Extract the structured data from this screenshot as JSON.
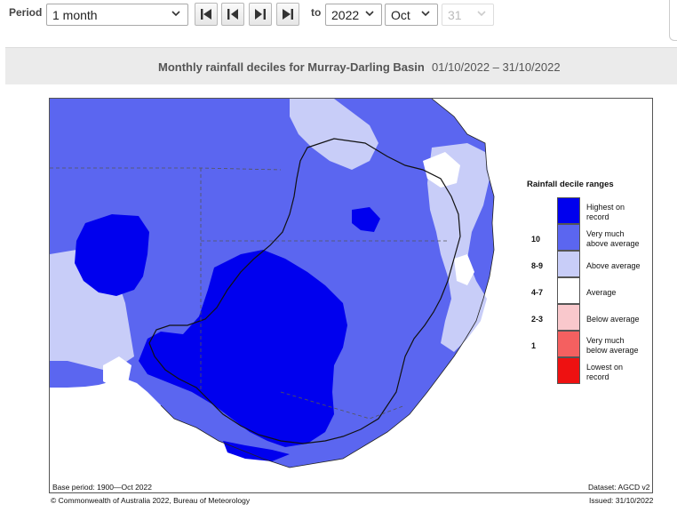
{
  "controls": {
    "period_label": "Period",
    "period_value": "1 month",
    "to_label": "to",
    "year_value": "2022",
    "month_value": "Oct",
    "day_value": "31"
  },
  "header": {
    "title": "Monthly rainfall deciles for Murray-Darling Basin",
    "date_range": "01/10/2022 – 31/10/2022"
  },
  "legend": {
    "title": "Rainfall decile ranges",
    "items": [
      {
        "code": "",
        "label_line1": "Highest on",
        "label_line2": "record",
        "color": "#0000ee"
      },
      {
        "code": "10",
        "label_line1": "Very much",
        "label_line2": "above average",
        "color": "#5b66f0"
      },
      {
        "code": "8-9",
        "label_line1": "Above average",
        "label_line2": "",
        "color": "#c8cdf8"
      },
      {
        "code": "4-7",
        "label_line1": "Average",
        "label_line2": "",
        "color": "#ffffff"
      },
      {
        "code": "2-3",
        "label_line1": "Below average",
        "label_line2": "",
        "color": "#f9c8cc"
      },
      {
        "code": "1",
        "label_line1": "Very much",
        "label_line2": "below average",
        "color": "#f46060"
      },
      {
        "code": "",
        "label_line1": "Lowest on",
        "label_line2": "record",
        "color": "#ee1111"
      }
    ]
  },
  "footer": {
    "base_period": "Base period: 1900—Oct 2022",
    "dataset": "Dataset: AGCD v2",
    "copyright": "© Commonwealth of Australia 2022, Bureau of Meteorology",
    "issued": "Issued: 31/10/2022"
  },
  "icons": {
    "first": "skip-first-icon",
    "prev": "step-back-icon",
    "next": "step-forward-icon",
    "last": "skip-last-icon"
  }
}
